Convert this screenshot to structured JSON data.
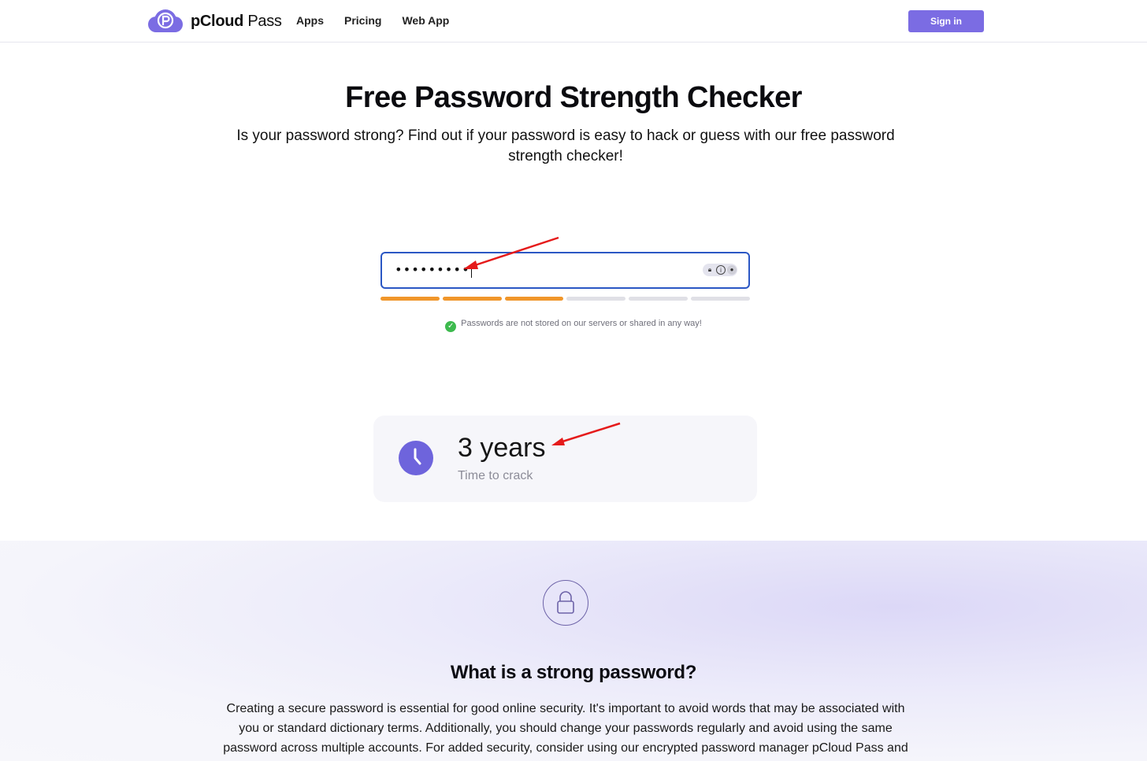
{
  "header": {
    "logo_text_bold": "pCloud",
    "logo_text_light": " Pass",
    "nav": [
      "Apps",
      "Pricing",
      "Web App"
    ],
    "signin_label": "Sign in"
  },
  "hero": {
    "title": "Free Password Strength Checker",
    "subtitle": "Is your password strong? Find out if your password is easy to hack or guess with our free password strength checker!"
  },
  "checker": {
    "password_masked": "•••••••••",
    "strength_segments_total": 6,
    "strength_segments_filled": 3,
    "strength_color": "#f0962a",
    "privacy_note": "Passwords are not stored on our servers or shared in any way!"
  },
  "result": {
    "time_value": "3 years",
    "time_label": "Time to crack"
  },
  "info": {
    "heading": "What is a strong password?",
    "paragraph": "Creating a secure password is essential for good online security. It's important to avoid words that may be associated with you or standard dictionary terms. Additionally, you should change your passwords regularly and avoid using the same password across multiple accounts. For added security, consider using our encrypted password manager pCloud Pass and"
  },
  "colors": {
    "accent": "#7b6ce3",
    "input_border": "#2b57c4",
    "annotation_arrow": "#e51b1b"
  }
}
